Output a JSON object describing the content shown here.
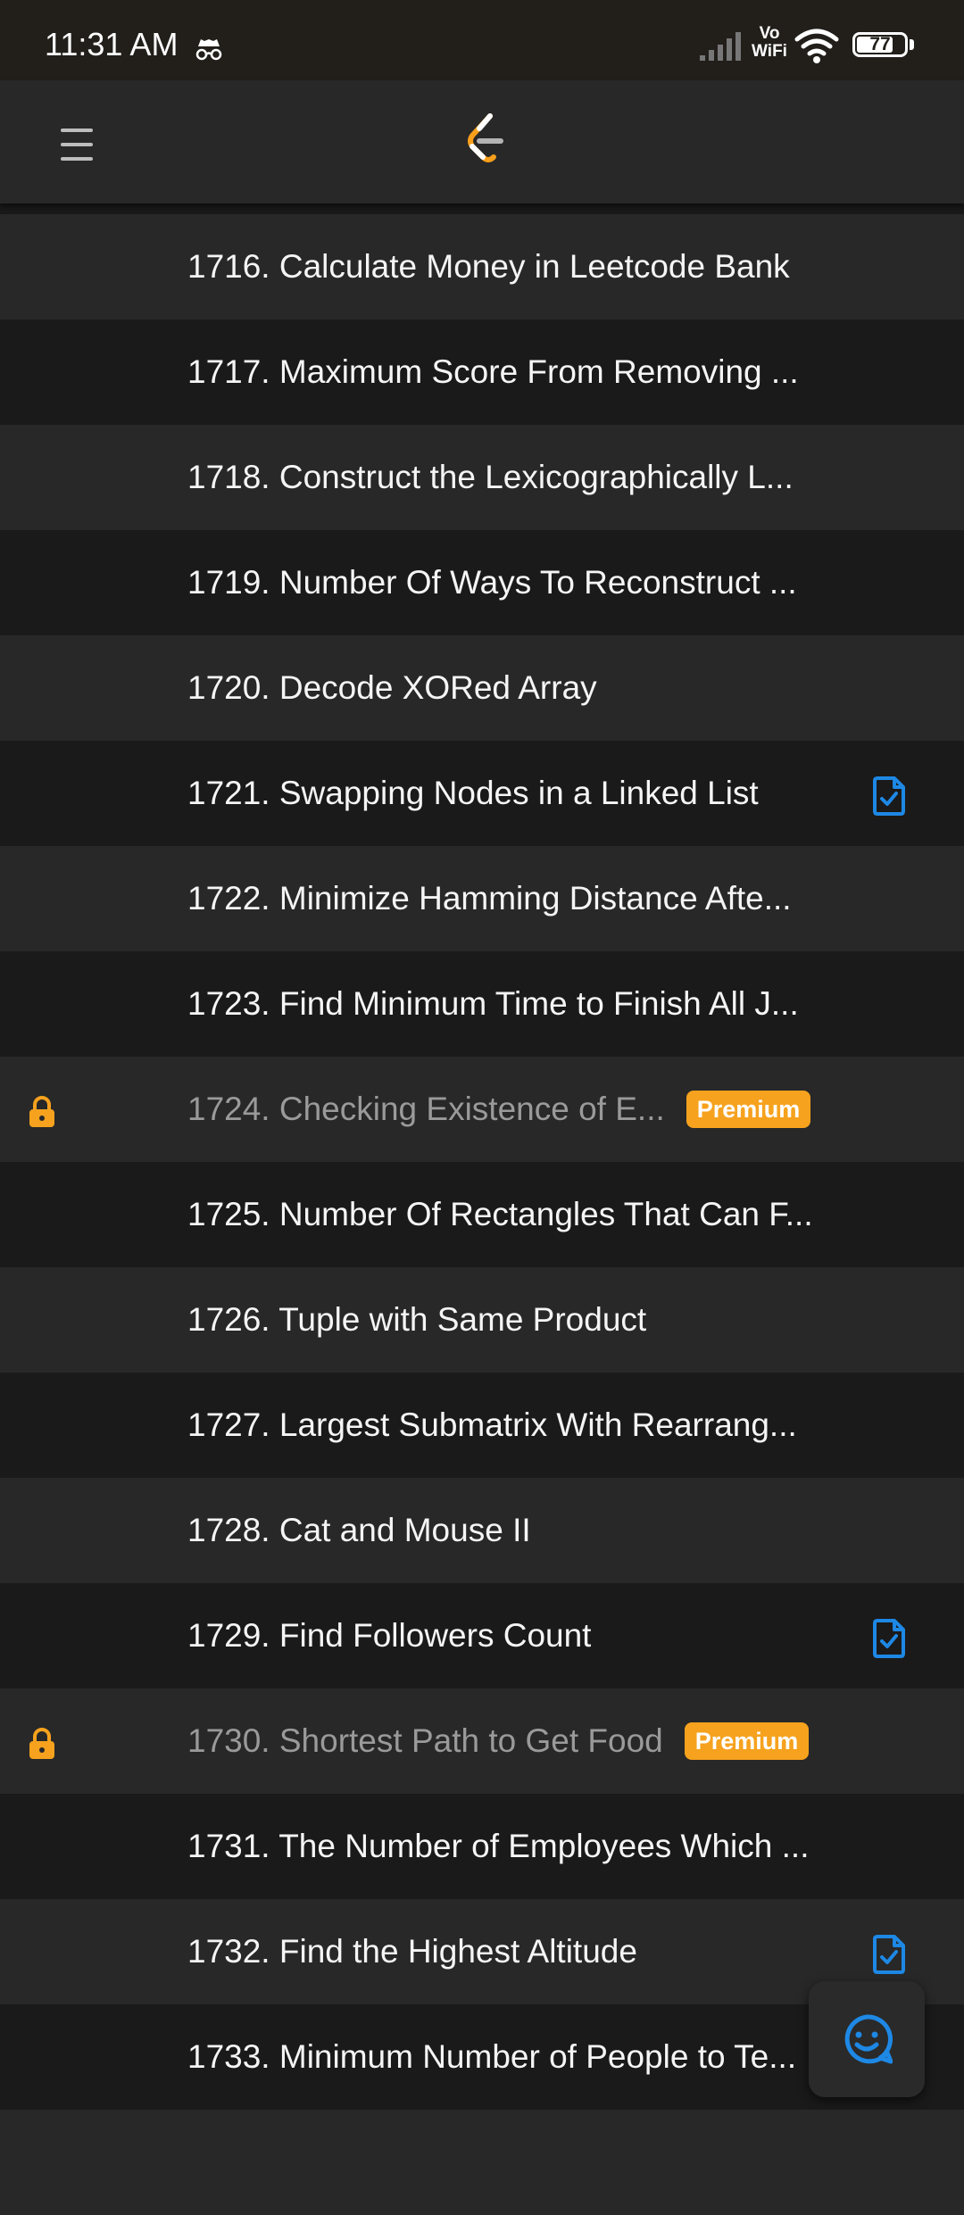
{
  "status_bar": {
    "time": "11:31 AM",
    "network_label": "Vo\nWiFi",
    "battery": "77",
    "battery_level": 0.77
  },
  "header": {
    "menu_icon": "hamburger-menu-icon",
    "logo_icon": "leetcode-logo-icon"
  },
  "colors": {
    "premium": "#f6a21e",
    "solution": "#1e88e5",
    "row_light": "#282828",
    "row_dark": "#1a1a1a"
  },
  "premium_label": "Premium",
  "problems": [
    {
      "title": "1716. Calculate Money in Leetcode Bank",
      "locked": false,
      "solution": false
    },
    {
      "title": "1717. Maximum Score From Removing ...",
      "locked": false,
      "solution": false
    },
    {
      "title": "1718. Construct the Lexicographically L...",
      "locked": false,
      "solution": false
    },
    {
      "title": "1719. Number Of Ways To Reconstruct ...",
      "locked": false,
      "solution": false
    },
    {
      "title": "1720. Decode XORed Array",
      "locked": false,
      "solution": false
    },
    {
      "title": "1721. Swapping Nodes in a Linked List",
      "locked": false,
      "solution": true
    },
    {
      "title": "1722. Minimize Hamming Distance Afte...",
      "locked": false,
      "solution": false
    },
    {
      "title": "1723. Find Minimum Time to Finish All J...",
      "locked": false,
      "solution": false
    },
    {
      "title": "1724. Checking Existence of E...",
      "locked": true,
      "solution": false
    },
    {
      "title": "1725. Number Of Rectangles That Can F...",
      "locked": false,
      "solution": false
    },
    {
      "title": "1726. Tuple with Same Product",
      "locked": false,
      "solution": false
    },
    {
      "title": "1727. Largest Submatrix With Rearrang...",
      "locked": false,
      "solution": false
    },
    {
      "title": "1728. Cat and Mouse II",
      "locked": false,
      "solution": false
    },
    {
      "title": "1729. Find Followers Count",
      "locked": false,
      "solution": true
    },
    {
      "title": "1730. Shortest Path to Get Food",
      "locked": true,
      "solution": false
    },
    {
      "title": "1731. The Number of Employees Which ...",
      "locked": false,
      "solution": false
    },
    {
      "title": "1732. Find the Highest Altitude",
      "locked": false,
      "solution": true
    },
    {
      "title": "1733. Minimum Number of People to Te...",
      "locked": false,
      "solution": false
    },
    {
      "title": "",
      "locked": false,
      "solution": false
    }
  ],
  "fab": {
    "icon": "chat-smiley-icon"
  }
}
